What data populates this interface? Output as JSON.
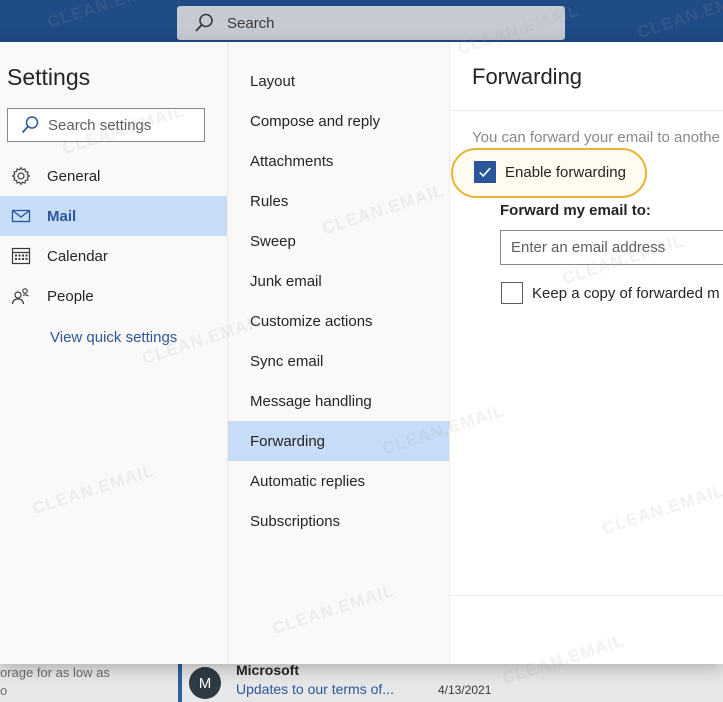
{
  "topbar": {
    "search_label": "Search"
  },
  "settings": {
    "title": "Settings",
    "search_placeholder": "Search settings",
    "nav": [
      {
        "label": "General",
        "icon": "gear-icon"
      },
      {
        "label": "Mail",
        "icon": "mail-icon",
        "selected": true
      },
      {
        "label": "Calendar",
        "icon": "calendar-icon"
      },
      {
        "label": "People",
        "icon": "people-icon"
      }
    ],
    "quick_link": "View quick settings"
  },
  "mail_sections": [
    "Layout",
    "Compose and reply",
    "Attachments",
    "Rules",
    "Sweep",
    "Junk email",
    "Customize actions",
    "Sync email",
    "Message handling",
    "Forwarding",
    "Automatic replies",
    "Subscriptions"
  ],
  "selected_section": "Forwarding",
  "forwarding": {
    "title": "Forwarding",
    "description": "You can forward your email to anothe",
    "enable_label": "Enable forwarding",
    "enable_checked": true,
    "forward_to_label": "Forward my email to:",
    "email_placeholder": "Enter an email address",
    "keep_copy_label": "Keep a copy of forwarded m",
    "keep_copy_checked": false
  },
  "background": {
    "promo_line1": "orage for as low as",
    "promo_line2": "o",
    "avatar_initial": "M",
    "sender": "Microsoft",
    "subject": "Updates to our terms of...",
    "date": "4/13/2021"
  },
  "watermark_text": "CLEAN.EMAIL",
  "colors": {
    "topbar": "#1f4b86",
    "accent": "#2b579a",
    "selected": "#c7dcf6",
    "highlight_ring": "#e8b330"
  }
}
